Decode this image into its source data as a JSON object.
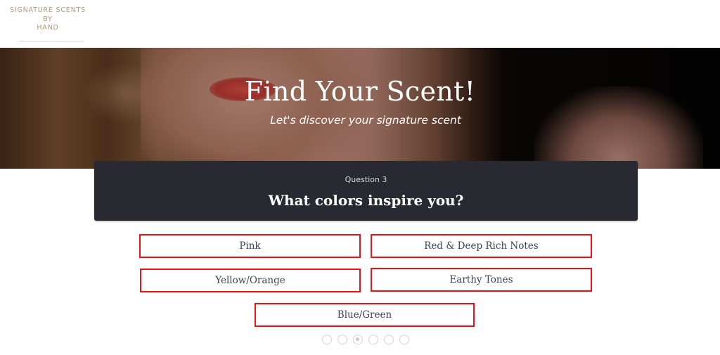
{
  "brand": {
    "logo_lines": [
      "SIGNATURE SCENTS",
      "BY",
      "HAND"
    ],
    "logo_color": "#b09a78"
  },
  "hero": {
    "title": "Find Your Scent!",
    "subtitle": "Let's discover your signature scent"
  },
  "quiz": {
    "question_number": "Question 3",
    "question_text": "What colors inspire you?",
    "answers": [
      {
        "label": "Pink"
      },
      {
        "label": "Red & Deep Rich Notes"
      },
      {
        "label": "Yellow/Orange"
      },
      {
        "label": "Earthy Tones"
      },
      {
        "label": "Blue/Green"
      }
    ],
    "answer_border_color": "#ee1111",
    "card_color": "#292a31",
    "progress": {
      "total_steps": 6,
      "current_step": 3
    }
  }
}
